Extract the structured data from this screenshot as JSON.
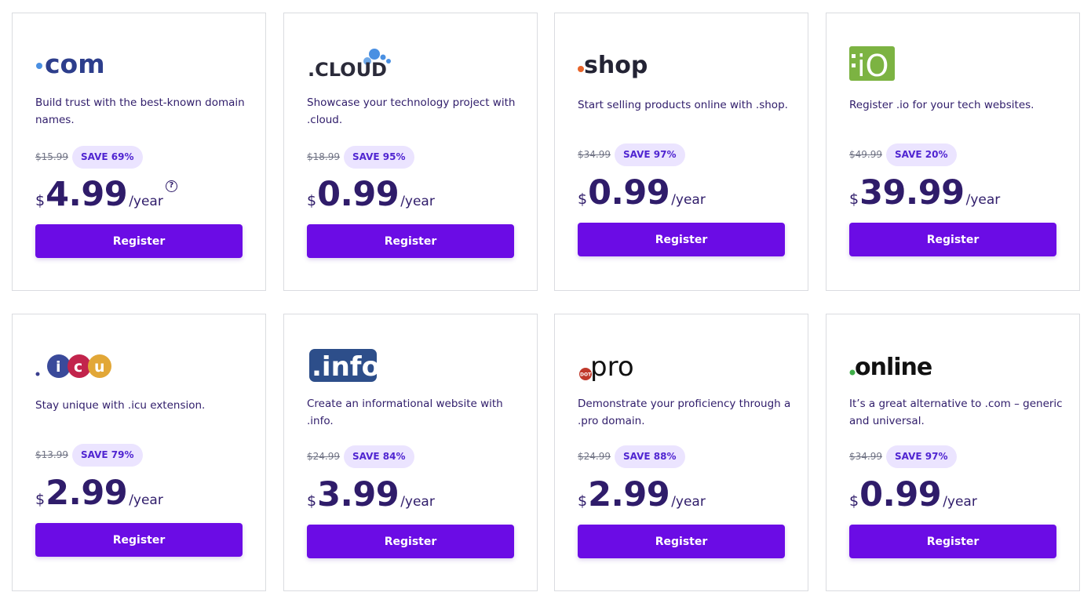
{
  "cards": [
    {
      "id": "com",
      "logo_text": ".com",
      "description": "Build trust with the best-known domain names.",
      "old_price": "$15.99",
      "save": "SAVE 69%",
      "currency": "$",
      "price": "4.99",
      "per": "/year",
      "help": "?",
      "button": "Register"
    },
    {
      "id": "cloud",
      "logo_text": ".CLOUD",
      "description": "Showcase your technology project with .cloud.",
      "old_price": "$18.99",
      "save": "SAVE 95%",
      "currency": "$",
      "price": "0.99",
      "per": "/year",
      "button": "Register"
    },
    {
      "id": "shop",
      "logo_text": ".shop",
      "description": "Start selling products online with .shop.",
      "old_price": "$34.99",
      "save": "SAVE 97%",
      "currency": "$",
      "price": "0.99",
      "per": "/year",
      "button": "Register"
    },
    {
      "id": "io",
      "logo_text": ".iO",
      "description": "Register .io for your tech websites.",
      "old_price": "$49.99",
      "save": "SAVE 20%",
      "currency": "$",
      "price": "39.99",
      "per": "/year",
      "button": "Register"
    },
    {
      "id": "icu",
      "logo_text": ".icu",
      "description": "Stay unique with .icu extension.",
      "old_price": "$13.99",
      "save": "SAVE 79%",
      "currency": "$",
      "price": "2.99",
      "per": "/year",
      "button": "Register"
    },
    {
      "id": "info",
      "logo_text": ".info",
      "description": "Create an informational website with .info.",
      "old_price": "$24.99",
      "save": "SAVE 84%",
      "currency": "$",
      "price": "3.99",
      "per": "/year",
      "button": "Register"
    },
    {
      "id": "pro",
      "logo_text": ".pro",
      "logo_badge": "DOT",
      "description": "Demonstrate your proficiency through a .pro domain.",
      "old_price": "$24.99",
      "save": "SAVE 88%",
      "currency": "$",
      "price": "2.99",
      "per": "/year",
      "button": "Register"
    },
    {
      "id": "online",
      "logo_text": ".online",
      "description": "It’s a great alternative to .com – generic and universal.",
      "old_price": "$34.99",
      "save": "SAVE 97%",
      "currency": "$",
      "price": "0.99",
      "per": "/year",
      "button": "Register"
    }
  ],
  "colors": {
    "accent": "#6b0ce5",
    "badge_bg": "#ebe4ff",
    "badge_text": "#5025d1",
    "price_text": "#2f1c6a",
    "border": "#dadce0"
  }
}
